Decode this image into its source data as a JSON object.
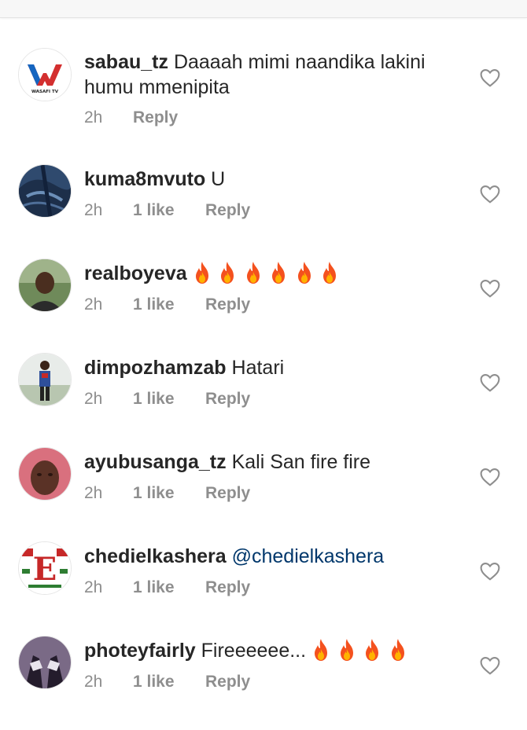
{
  "colors": {
    "username": "#262626",
    "meta": "#8e8e8e",
    "mention": "#00376b",
    "fire_outer": "#f4511e",
    "fire_inner": "#ffb300"
  },
  "icons": {
    "like": "heart-outline-icon",
    "emoji": "fire-emoji"
  },
  "comments": [
    {
      "username": "sabau_tz",
      "text": "Daaaah mimi naandika lakini humu mmenipita",
      "time": "2h",
      "likes": "",
      "reply": "Reply",
      "avatar_label": "WASAFI TV"
    },
    {
      "username": "kuma8mvuto",
      "text": "U",
      "time": "2h",
      "likes": "1 like",
      "reply": "Reply"
    },
    {
      "username": "realboyeva",
      "text": "",
      "fire_count": 6,
      "time": "2h",
      "likes": "1 like",
      "reply": "Reply"
    },
    {
      "username": "dimpozhamzab",
      "text": "Hatari",
      "time": "2h",
      "likes": "1 like",
      "reply": "Reply"
    },
    {
      "username": "ayubusanga_tz",
      "text": "Kali San fire fire",
      "time": "2h",
      "likes": "1 like",
      "reply": "Reply"
    },
    {
      "username": "chedielkashera",
      "mention": "@chedielkashera",
      "time": "2h",
      "likes": "1 like",
      "reply": "Reply"
    },
    {
      "username": "photeyfairly",
      "text": "Fireeeeee...",
      "fire_count": 4,
      "time": "2h",
      "likes": "1 like",
      "reply": "Reply"
    }
  ]
}
